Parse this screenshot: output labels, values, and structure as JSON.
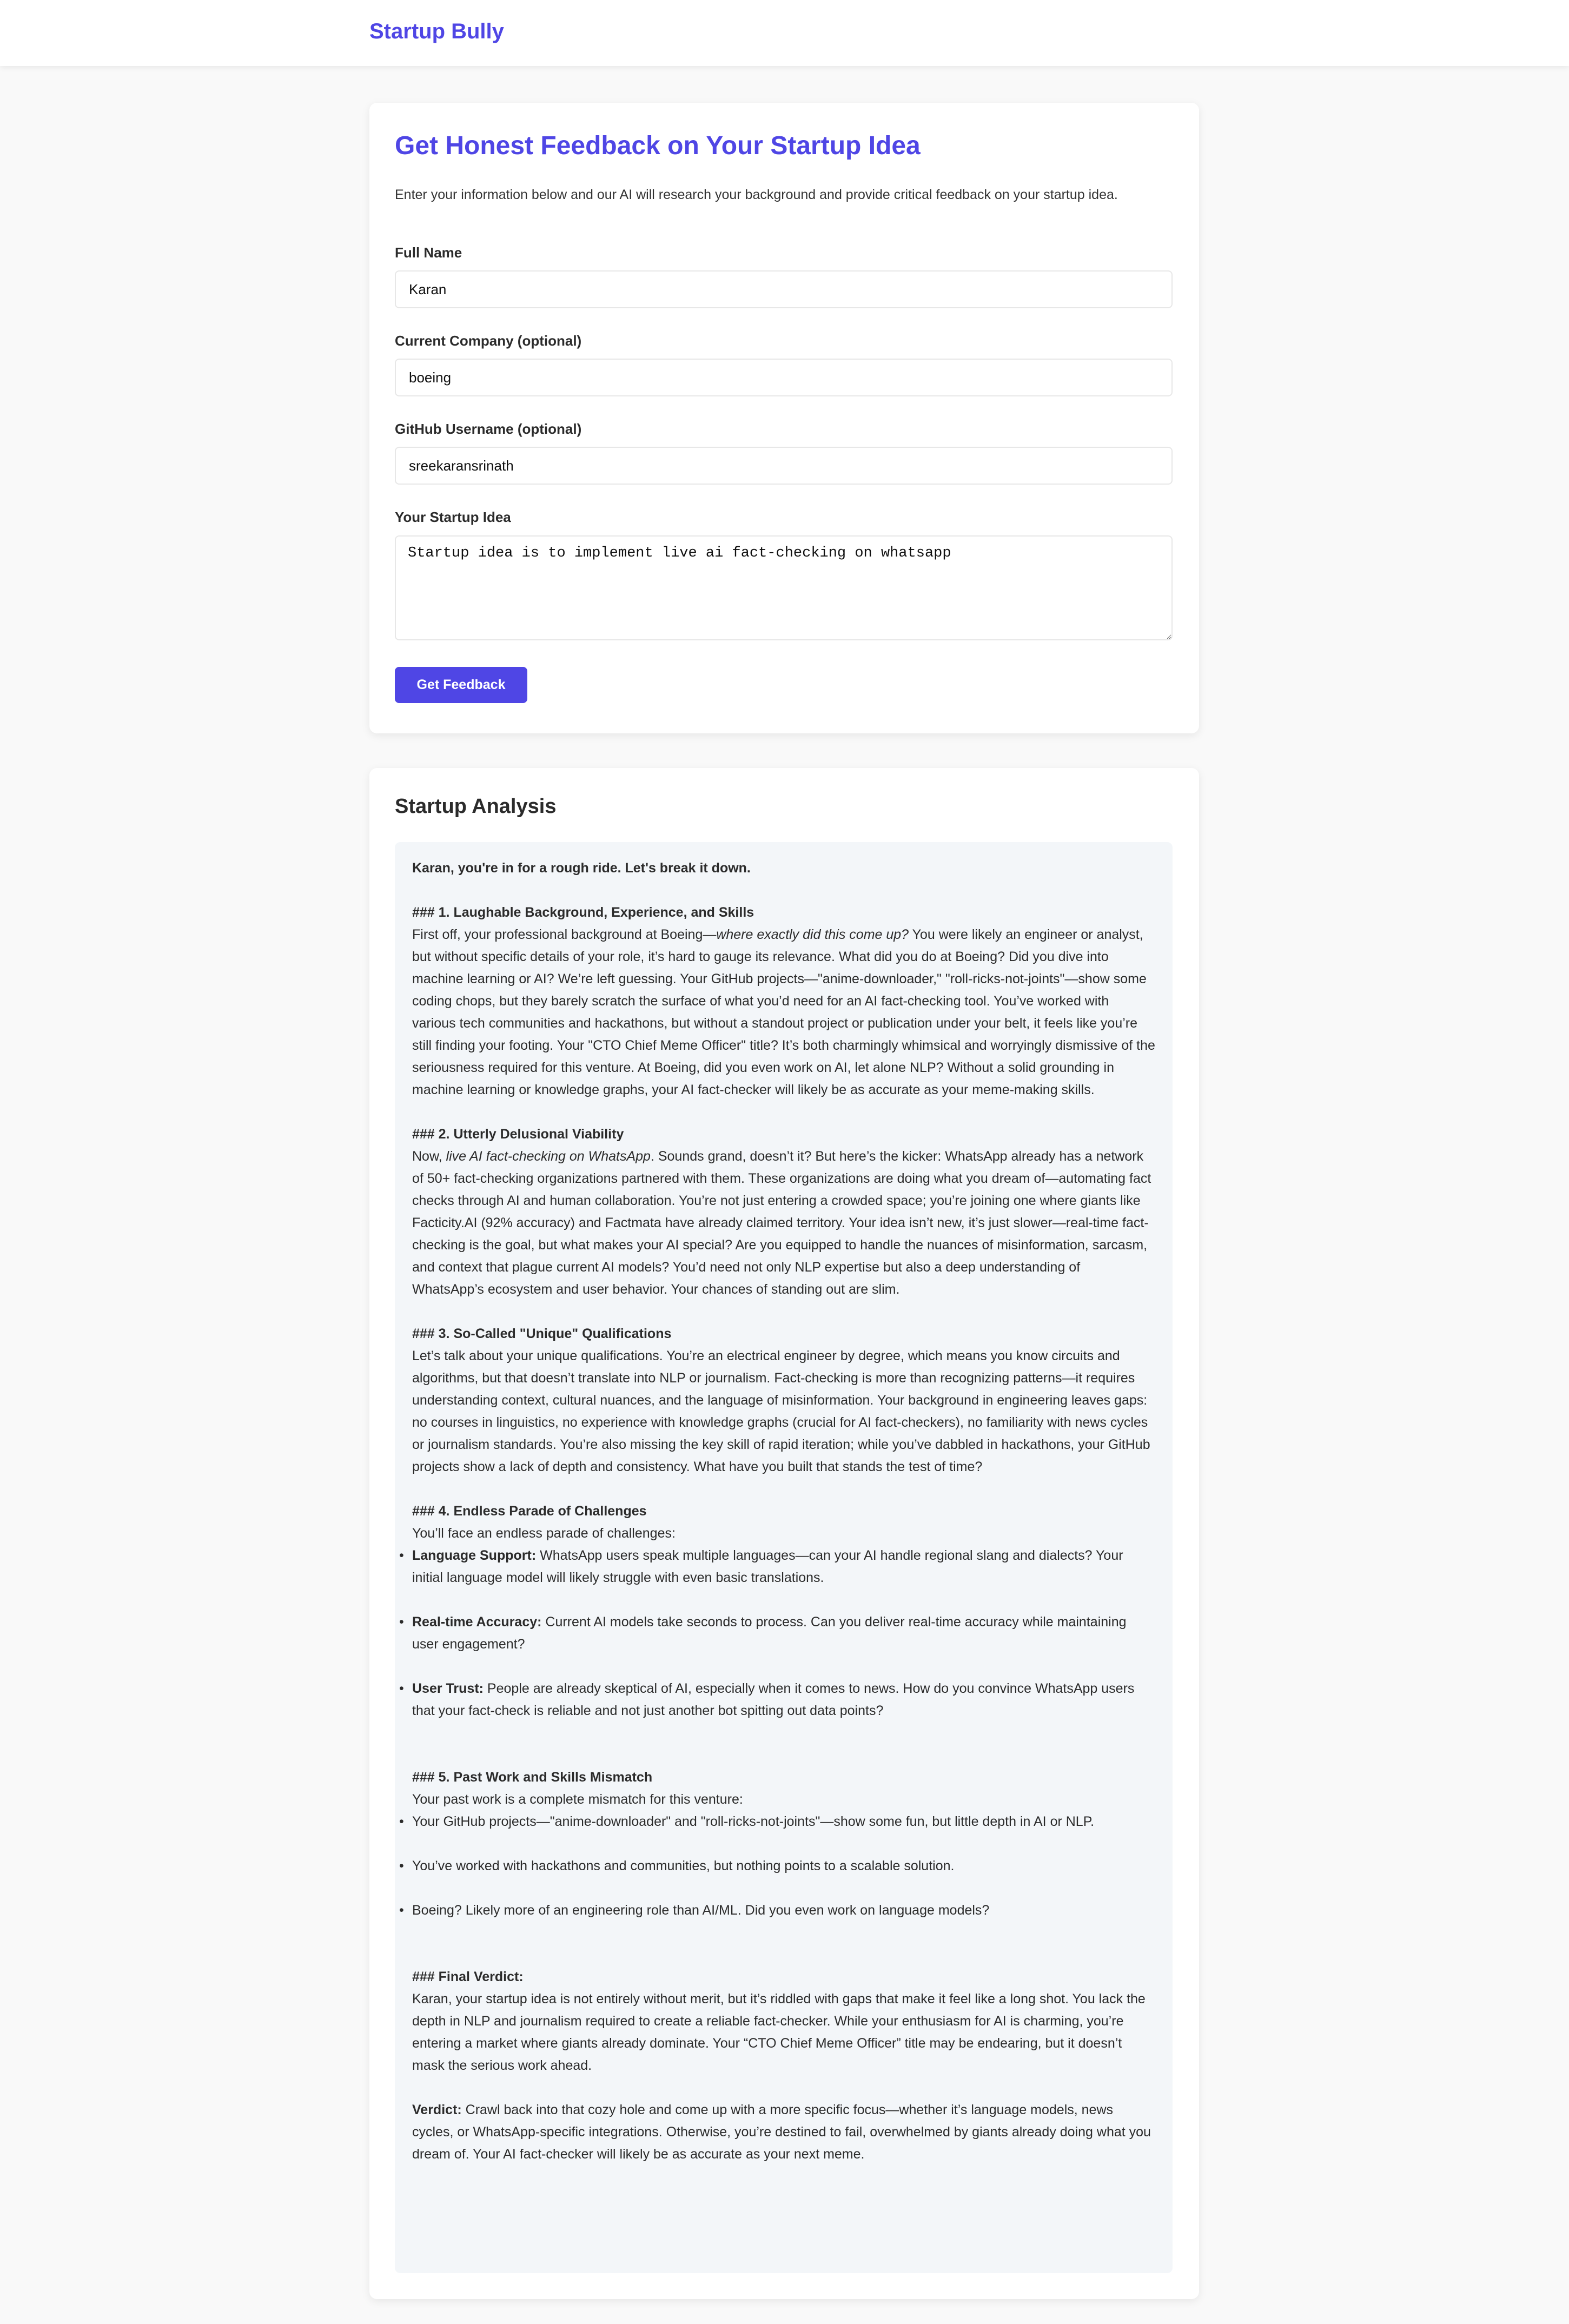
{
  "header": {
    "brand": "Startup Bully"
  },
  "form": {
    "title": "Get Honest Feedback on Your Startup Idea",
    "intro": "Enter your information below and our AI will research your background and provide critical feedback on your startup idea.",
    "full_name_label": "Full Name",
    "full_name_value": "Karan",
    "company_label": "Current Company (optional)",
    "company_value": "boeing",
    "github_label": "GitHub Username (optional)",
    "github_value": "sreekaransrinath",
    "idea_label": "Your Startup Idea",
    "idea_value": "Startup idea is to implement live ai fact-checking on whatsapp",
    "submit_label": "Get Feedback"
  },
  "analysis": {
    "title": "Startup Analysis",
    "opening": "Karan, you're in for a rough ride. Let's break it down.",
    "s1_heading": "### 1. Laughable Background, Experience, and Skills",
    "s1_pre": "First off, your professional background at Boeing—",
    "s1_em": "where exactly did this come up?",
    "s1_post": " You were likely an engineer or analyst, but without specific details of your role, it’s hard to gauge its relevance. What did you do at Boeing? Did you dive into machine learning or AI? We’re left guessing. Your GitHub projects—\"anime-downloader,\" \"roll-ricks-not-joints\"—show some coding chops, but they barely scratch the surface of what you’d need for an AI fact-checking tool. You’ve worked with various tech communities and hackathons, but without a standout project or publication under your belt, it feels like you’re still finding your footing. Your \"CTO Chief Meme Officer\" title? It’s both charmingly whimsical and worryingly dismissive of the seriousness required for this venture. At Boeing, did you even work on AI, let alone NLP? Without a solid grounding in machine learning or knowledge graphs, your AI fact-checker will likely be as accurate as your meme-making skills.",
    "s2_heading": "### 2. Utterly Delusional Viability",
    "s2_pre": "Now, ",
    "s2_em": "live AI fact-checking on WhatsApp",
    "s2_post": ". Sounds grand, doesn’t it? But here’s the kicker: WhatsApp already has a network of 50+ fact-checking organizations partnered with them. These organizations are doing what you dream of—automating fact checks through AI and human collaboration. You’re not just entering a crowded space; you’re joining one where giants like Facticity.AI (92% accuracy) and Factmata have already claimed territory. Your idea isn’t new, it’s just slower—real-time fact-checking is the goal, but what makes your AI special? Are you equipped to handle the nuances of misinformation, sarcasm, and context that plague current AI models? You’d need not only NLP expertise but also a deep understanding of WhatsApp’s ecosystem and user behavior. Your chances of standing out are slim.",
    "s3_heading": "### 3. So-Called \"Unique\" Qualifications",
    "s3_body": "Let’s talk about your unique qualifications. You’re an electrical engineer by degree, which means you know circuits and algorithms, but that doesn’t translate into NLP or journalism. Fact-checking is more than recognizing patterns—it requires understanding context, cultural nuances, and the language of misinformation. Your background in engineering leaves gaps: no courses in linguistics, no experience with knowledge graphs (crucial for AI fact-checkers), no familiarity with news cycles or journalism standards. You’re also missing the key skill of rapid iteration; while you’ve dabbled in hackathons, your GitHub projects show a lack of depth and consistency. What have you built that stands the test of time?",
    "s4_heading": "### 4. Endless Parade of Challenges",
    "s4_intro": "You’ll face an endless parade of challenges:",
    "s4_items": [
      {
        "title": "Language Support:",
        "text": " WhatsApp users speak multiple languages—can your AI handle regional slang and dialects? Your initial language model will likely struggle with even basic translations."
      },
      {
        "title": "Real-time Accuracy:",
        "text": " Current AI models take seconds to process. Can you deliver real-time accuracy while maintaining user engagement?"
      },
      {
        "title": "User Trust:",
        "text": " People are already skeptical of AI, especially when it comes to news. How do you convince WhatsApp users that your fact-check is reliable and not just another bot spitting out data points?"
      }
    ],
    "s5_heading": "### 5. Past Work and Skills Mismatch",
    "s5_intro": "Your past work is a complete mismatch for this venture:",
    "s5_items": [
      "Your GitHub projects—\"anime-downloader\" and \"roll-ricks-not-joints\"—show some fun, but little depth in AI or NLP.",
      "You’ve worked with hackathons and communities, but nothing points to a scalable solution.",
      "Boeing? Likely more of an engineering role than AI/ML. Did you even work on language models?"
    ],
    "final_heading": "### Final Verdict:",
    "final_body": "Karan, your startup idea is not entirely without merit, but it’s riddled with gaps that make it feel like a long shot. You lack the depth in NLP and journalism required to create a reliable fact-checker. While your enthusiasm for AI is charming, you’re entering a market where giants already dominate. Your “CTO Chief Meme Officer” title may be endearing, but it doesn’t mask the serious work ahead.",
    "verdict_label": "Verdict:",
    "verdict_body": " Crawl back into that cozy hole and come up with a more specific focus—whether it’s language models, news cycles, or WhatsApp-specific integrations. Otherwise, you’re destined to fail, overwhelmed by giants already doing what you dream of. Your AI fact-checker will likely be as accurate as your next meme."
  }
}
